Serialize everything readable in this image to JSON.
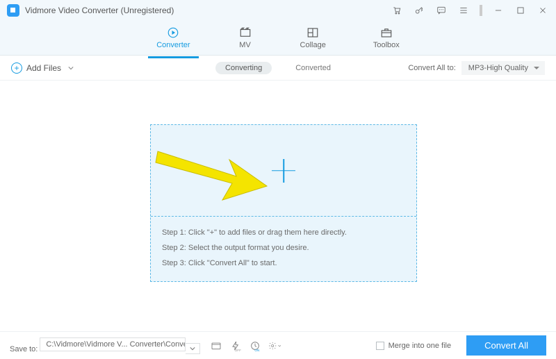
{
  "title": "Vidmore Video Converter (Unregistered)",
  "tabs": {
    "converter": "Converter",
    "mv": "MV",
    "collage": "Collage",
    "toolbox": "Toolbox"
  },
  "actionbar": {
    "add_files": "Add Files",
    "converting": "Converting",
    "converted": "Converted",
    "convert_all_to": "Convert All to:",
    "format": "MP3-High Quality"
  },
  "steps": {
    "s1": "Step 1: Click \"+\" to add files or drag them here directly.",
    "s2": "Step 2: Select the output format you desire.",
    "s3": "Step 3: Click \"Convert All\" to start."
  },
  "bottom": {
    "save_to": "Save to:",
    "path": "C:\\Vidmore\\Vidmore V... Converter\\Converted",
    "merge": "Merge into one file",
    "convert_all": "Convert All"
  }
}
